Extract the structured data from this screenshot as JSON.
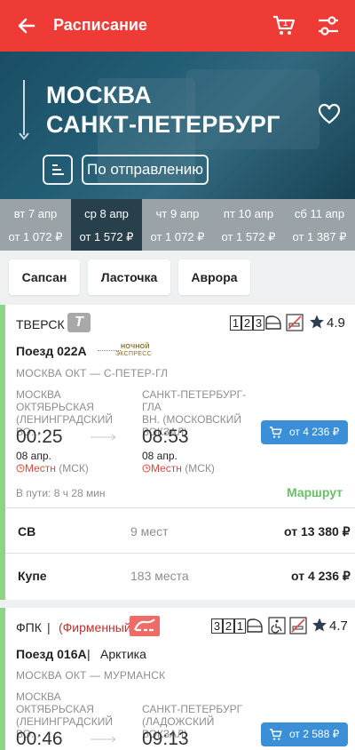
{
  "header": {
    "title": "Расписание",
    "cart_count": "1"
  },
  "route": {
    "from": "МОСКВА",
    "to": "САНКТ-ПЕТЕРБУРГ",
    "sort_label": "По отправлению"
  },
  "dates": [
    {
      "day": "вт 7 апр",
      "price": "от 1 072 ₽"
    },
    {
      "day": "ср 8 апр",
      "price": "от 1 572 ₽",
      "active": true
    },
    {
      "day": "чт 9 апр",
      "price": "от 1 072 ₽"
    },
    {
      "day": "пт 10 апр",
      "price": "от 1 572 ₽"
    },
    {
      "day": "сб 11 апр",
      "price": "от 1 387 ₽"
    }
  ],
  "filters": [
    "Сапсан",
    "Ласточка",
    "Аврора"
  ],
  "trains": [
    {
      "carrier": "ТВЕРСК",
      "carrier_badge": "Т",
      "classes": [
        "1",
        "2",
        "3"
      ],
      "rating": "4.9",
      "number": "Поезд 022А",
      "brand_logo": [
        "НОЧНОЙ",
        "ЭКСПРЕСС"
      ],
      "route": "МОСКВА ОКТ — С-ПЕТЕР-ГЛ",
      "dep_station": [
        "МОСКВА",
        "ОКТЯБРЬСКАЯ",
        "(ЛЕНИНГРАДСКИЙ ВО..."
      ],
      "arr_station": [
        "САНКТ-ПЕТЕРБУРГ-ГЛА",
        "ВН. (МОСКОВСКИЙ",
        "ВОКЗАЛ)"
      ],
      "dep_time": "00:25",
      "arr_time": "08:53",
      "dep_date": "08 апр.",
      "arr_date": "08 апр.",
      "local_label": "Местн",
      "tz": "(МСК)",
      "price": "от 4 236 ₽",
      "travel_time": "В пути: 8 ч 28 мин",
      "route_link": "Маршрут",
      "seats": [
        {
          "type": "СВ",
          "count": "9 мест",
          "price": "от 13 380 ₽"
        },
        {
          "type": "Купе",
          "count": "183 места",
          "price": "от 4 236 ₽"
        }
      ]
    },
    {
      "carrier": "ФПК",
      "separator": "|",
      "firm": "(Фирменный)",
      "classes": [
        "3",
        "2",
        "1"
      ],
      "rating": "4.7",
      "number": "Поезд 016А",
      "name": "Арктика",
      "route": "МОСКВА ОКТ — МУРМАНСК",
      "dep_station": [
        "МОСКВА",
        "ОКТЯБРЬСКАЯ",
        "(ЛЕНИНГРАДСКИЙ ВО..."
      ],
      "arr_station": [
        "САНКТ-ПЕТЕРБУРГ",
        "(ЛАДОЖСКИЙ ВОКЗАЛ)"
      ],
      "dep_time": "00:46",
      "arr_time": "09:13",
      "price": "от 2 588 ₽"
    }
  ],
  "colors": {
    "header": "#ee3b36",
    "accent_blue": "#3b8fd6",
    "green": "#6bbf66",
    "date_active": "#27404b"
  }
}
